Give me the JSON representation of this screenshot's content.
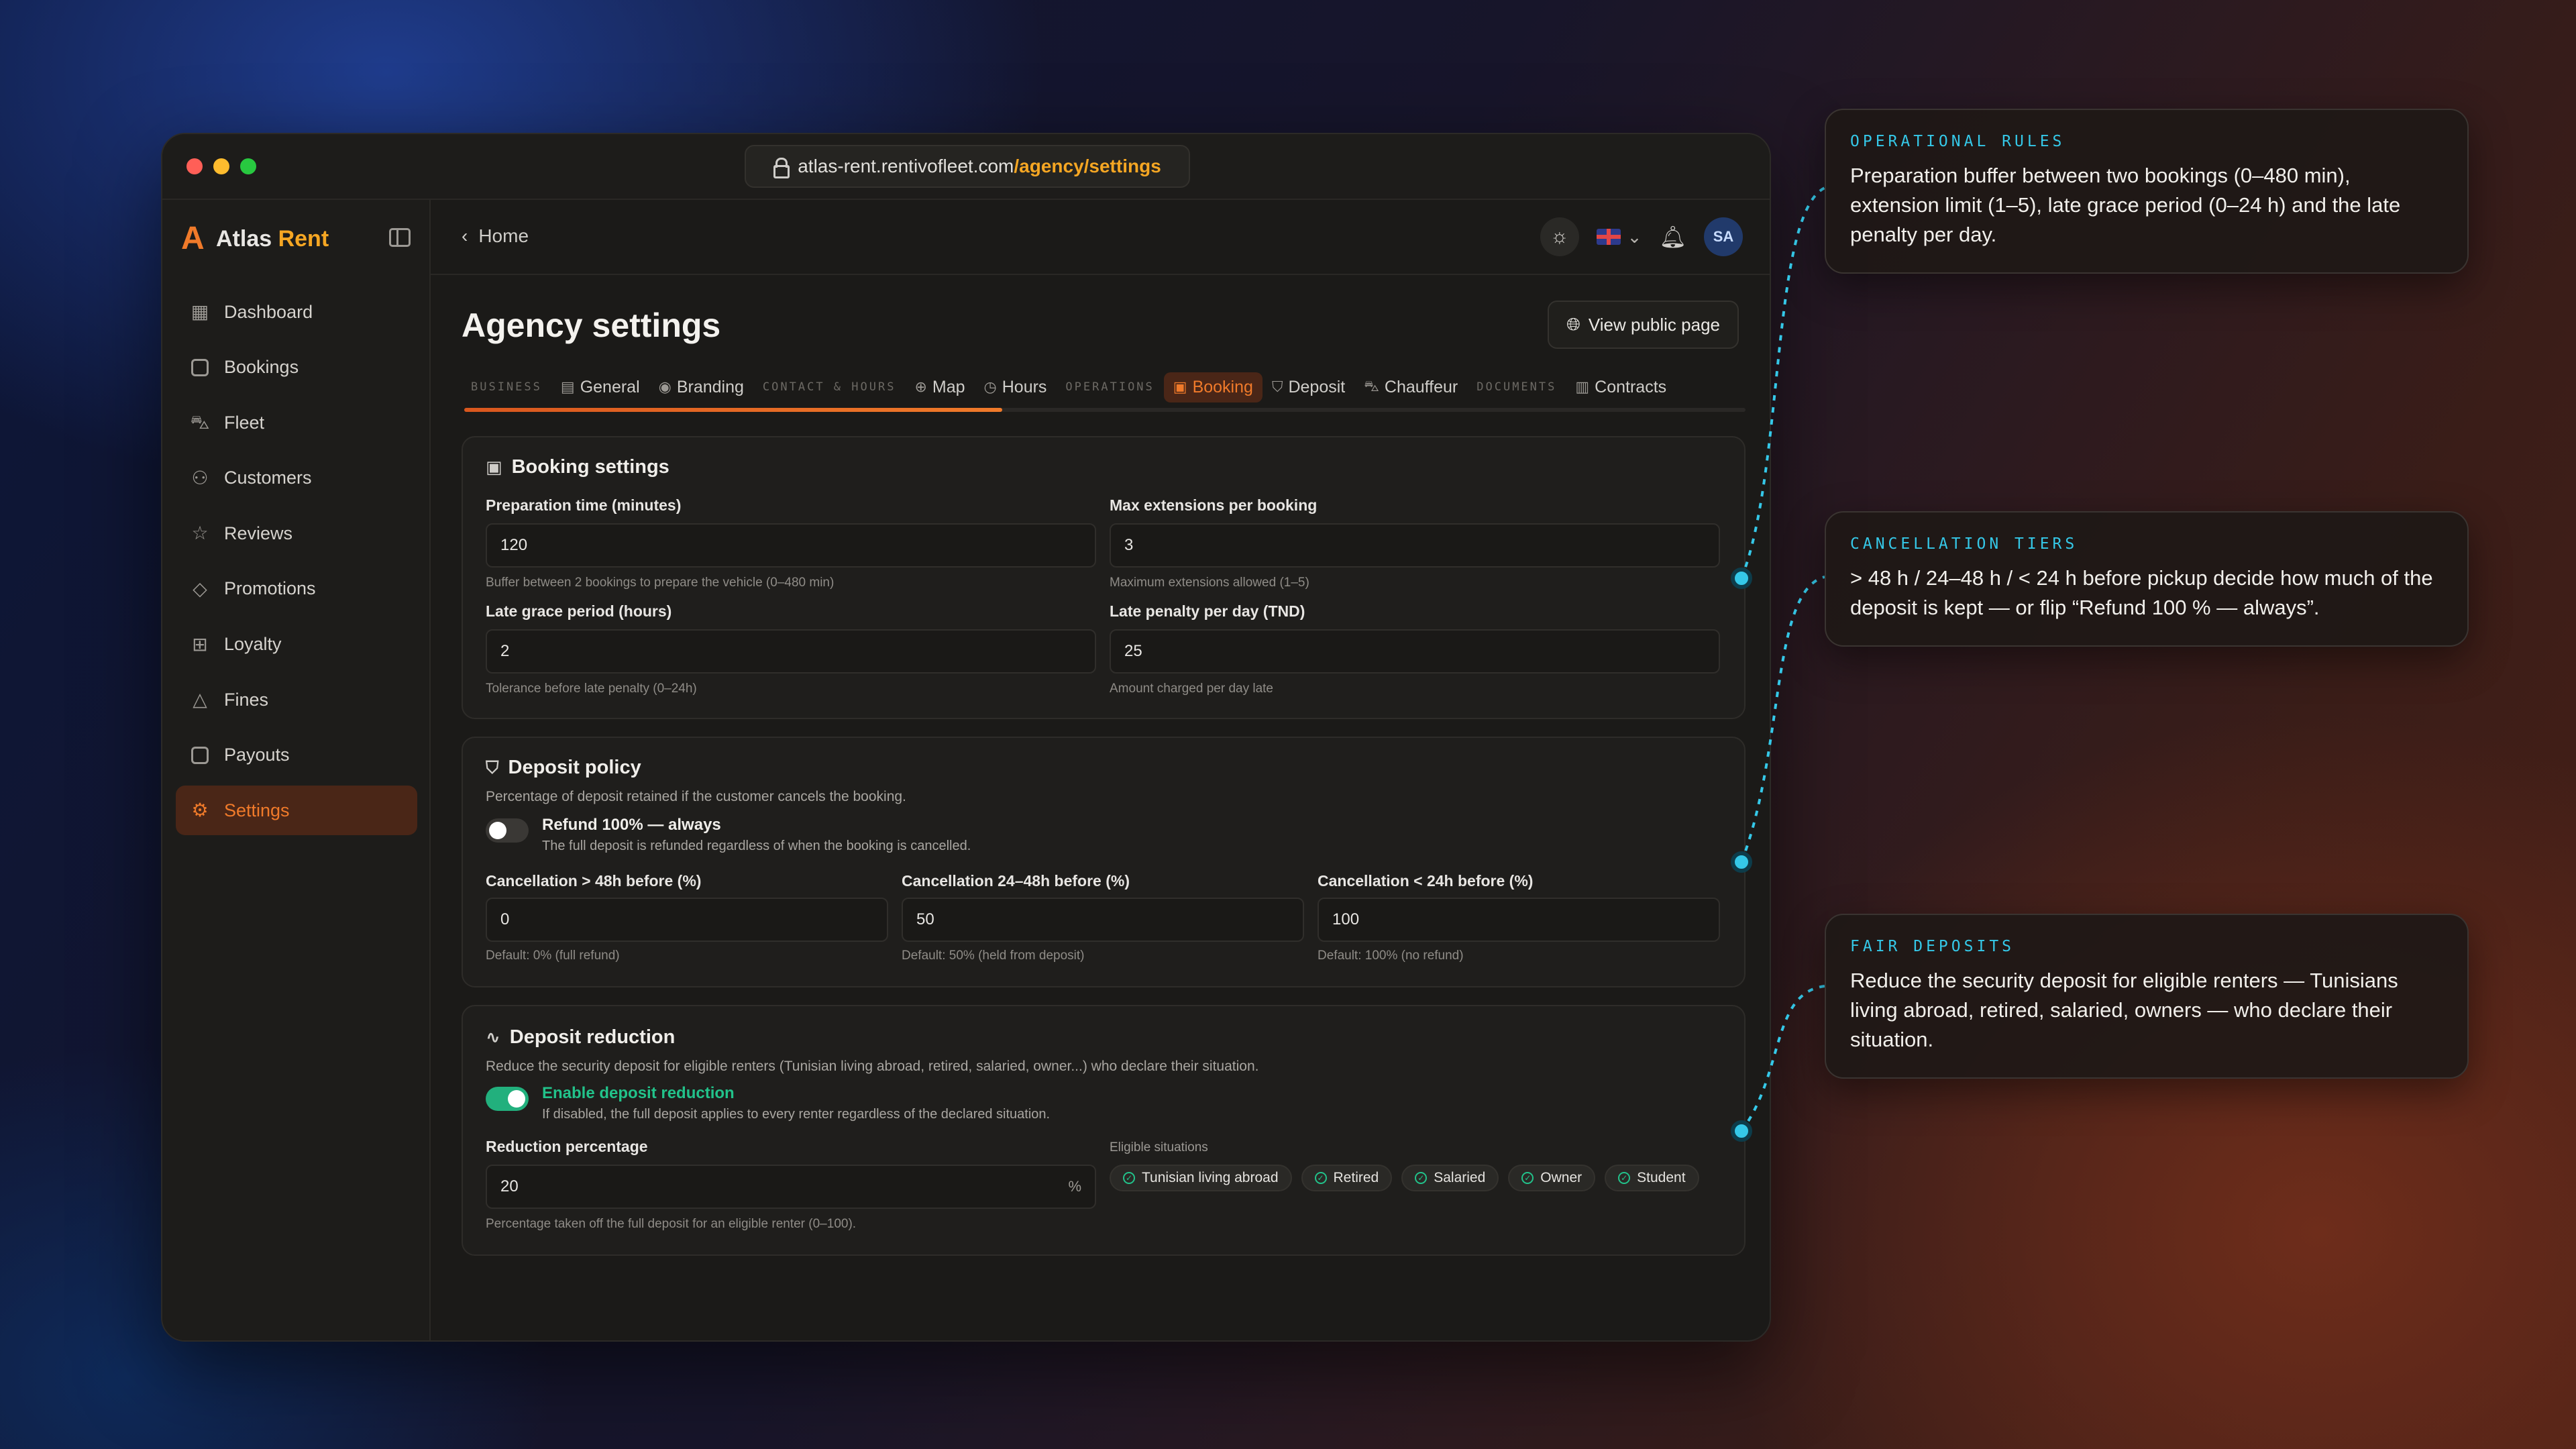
{
  "browser": {
    "url_host": "atlas-rent.rentivofleet.com",
    "url_path": "/agency/settings"
  },
  "brand": {
    "name_part1": "Atlas",
    "name_part2": "Rent"
  },
  "sidebar": {
    "items": [
      {
        "label": "Dashboard",
        "icon": "grid-icon"
      },
      {
        "label": "Bookings",
        "icon": "calendar-icon"
      },
      {
        "label": "Fleet",
        "icon": "car-icon"
      },
      {
        "label": "Customers",
        "icon": "users-icon"
      },
      {
        "label": "Reviews",
        "icon": "star-icon"
      },
      {
        "label": "Promotions",
        "icon": "tag-icon"
      },
      {
        "label": "Loyalty",
        "icon": "gift-icon"
      },
      {
        "label": "Fines",
        "icon": "warning-icon"
      },
      {
        "label": "Payouts",
        "icon": "wallet-icon"
      },
      {
        "label": "Settings",
        "icon": "gear-icon",
        "active": true
      }
    ]
  },
  "topbar": {
    "back_label": "Home",
    "avatar_initials": "SA"
  },
  "page": {
    "title": "Agency settings",
    "view_public_label": "View public page"
  },
  "tabs": {
    "group_business": "BUSINESS",
    "general": "General",
    "branding": "Branding",
    "group_contact": "CONTACT & HOURS",
    "map": "Map",
    "hours": "Hours",
    "group_operations": "OPERATIONS",
    "booking": "Booking",
    "deposit": "Deposit",
    "chauffeur": "Chauffeur",
    "group_documents": "DOCUMENTS",
    "contracts": "Contracts",
    "progress_fraction": 0.42
  },
  "booking_settings": {
    "title": "Booking settings",
    "prep_label": "Preparation time (minutes)",
    "prep_value": "120",
    "prep_help": "Buffer between 2 bookings to prepare the vehicle (0–480 min)",
    "ext_label": "Max extensions per booking",
    "ext_value": "3",
    "ext_help": "Maximum extensions allowed (1–5)",
    "grace_label": "Late grace period (hours)",
    "grace_value": "2",
    "grace_help": "Tolerance before late penalty (0–24h)",
    "penalty_label": "Late penalty per day (TND)",
    "penalty_value": "25",
    "penalty_help": "Amount charged per day late"
  },
  "deposit_policy": {
    "title": "Deposit policy",
    "description": "Percentage of deposit retained if the customer cancels the booking.",
    "toggle_title": "Refund 100% — always",
    "toggle_sub": "The full deposit is refunded regardless of when the booking is cancelled.",
    "toggle_on": false,
    "c1_label": "Cancellation > 48h before (%)",
    "c1_value": "0",
    "c1_help": "Default: 0% (full refund)",
    "c2_label": "Cancellation 24–48h before (%)",
    "c2_value": "50",
    "c2_help": "Default: 50% (held from deposit)",
    "c3_label": "Cancellation < 24h before (%)",
    "c3_value": "100",
    "c3_help": "Default: 100% (no refund)"
  },
  "deposit_reduction": {
    "title": "Deposit reduction",
    "description": "Reduce the security deposit for eligible renters (Tunisian living abroad, retired, salaried, owner...) who declare their situation.",
    "toggle_title": "Enable deposit reduction",
    "toggle_sub": "If disabled, the full deposit applies to every renter regardless of the declared situation.",
    "toggle_on": true,
    "reduction_label": "Reduction percentage",
    "reduction_value": "20",
    "reduction_suffix": "%",
    "reduction_help": "Percentage taken off the full deposit for an eligible renter (0–100).",
    "eligible_label": "Eligible situations",
    "situations": [
      "Tunisian living abroad",
      "Retired",
      "Salaried",
      "Owner",
      "Student"
    ]
  },
  "callouts": [
    {
      "tag": "OPERATIONAL RULES",
      "text": "Preparation buffer between two bookings (0–480 min), extension limit (1–5), late grace period (0–24 h) and the late penalty per day."
    },
    {
      "tag": "CANCELLATION TIERS",
      "text": "> 48 h / 24–48 h / < 24 h before pickup decide how much of the deposit is kept — or flip “Refund 100 % — always”."
    },
    {
      "tag": "FAIR DEPOSITS",
      "text": "Reduce the security deposit for eligible renters — Tunisians living abroad, retired, salaried, owners — who declare their situation."
    }
  ],
  "colors": {
    "accent": "#f07a2a",
    "brand_accent": "#f5a623",
    "success": "#22c28a",
    "callout_tag": "#35c8e8"
  }
}
